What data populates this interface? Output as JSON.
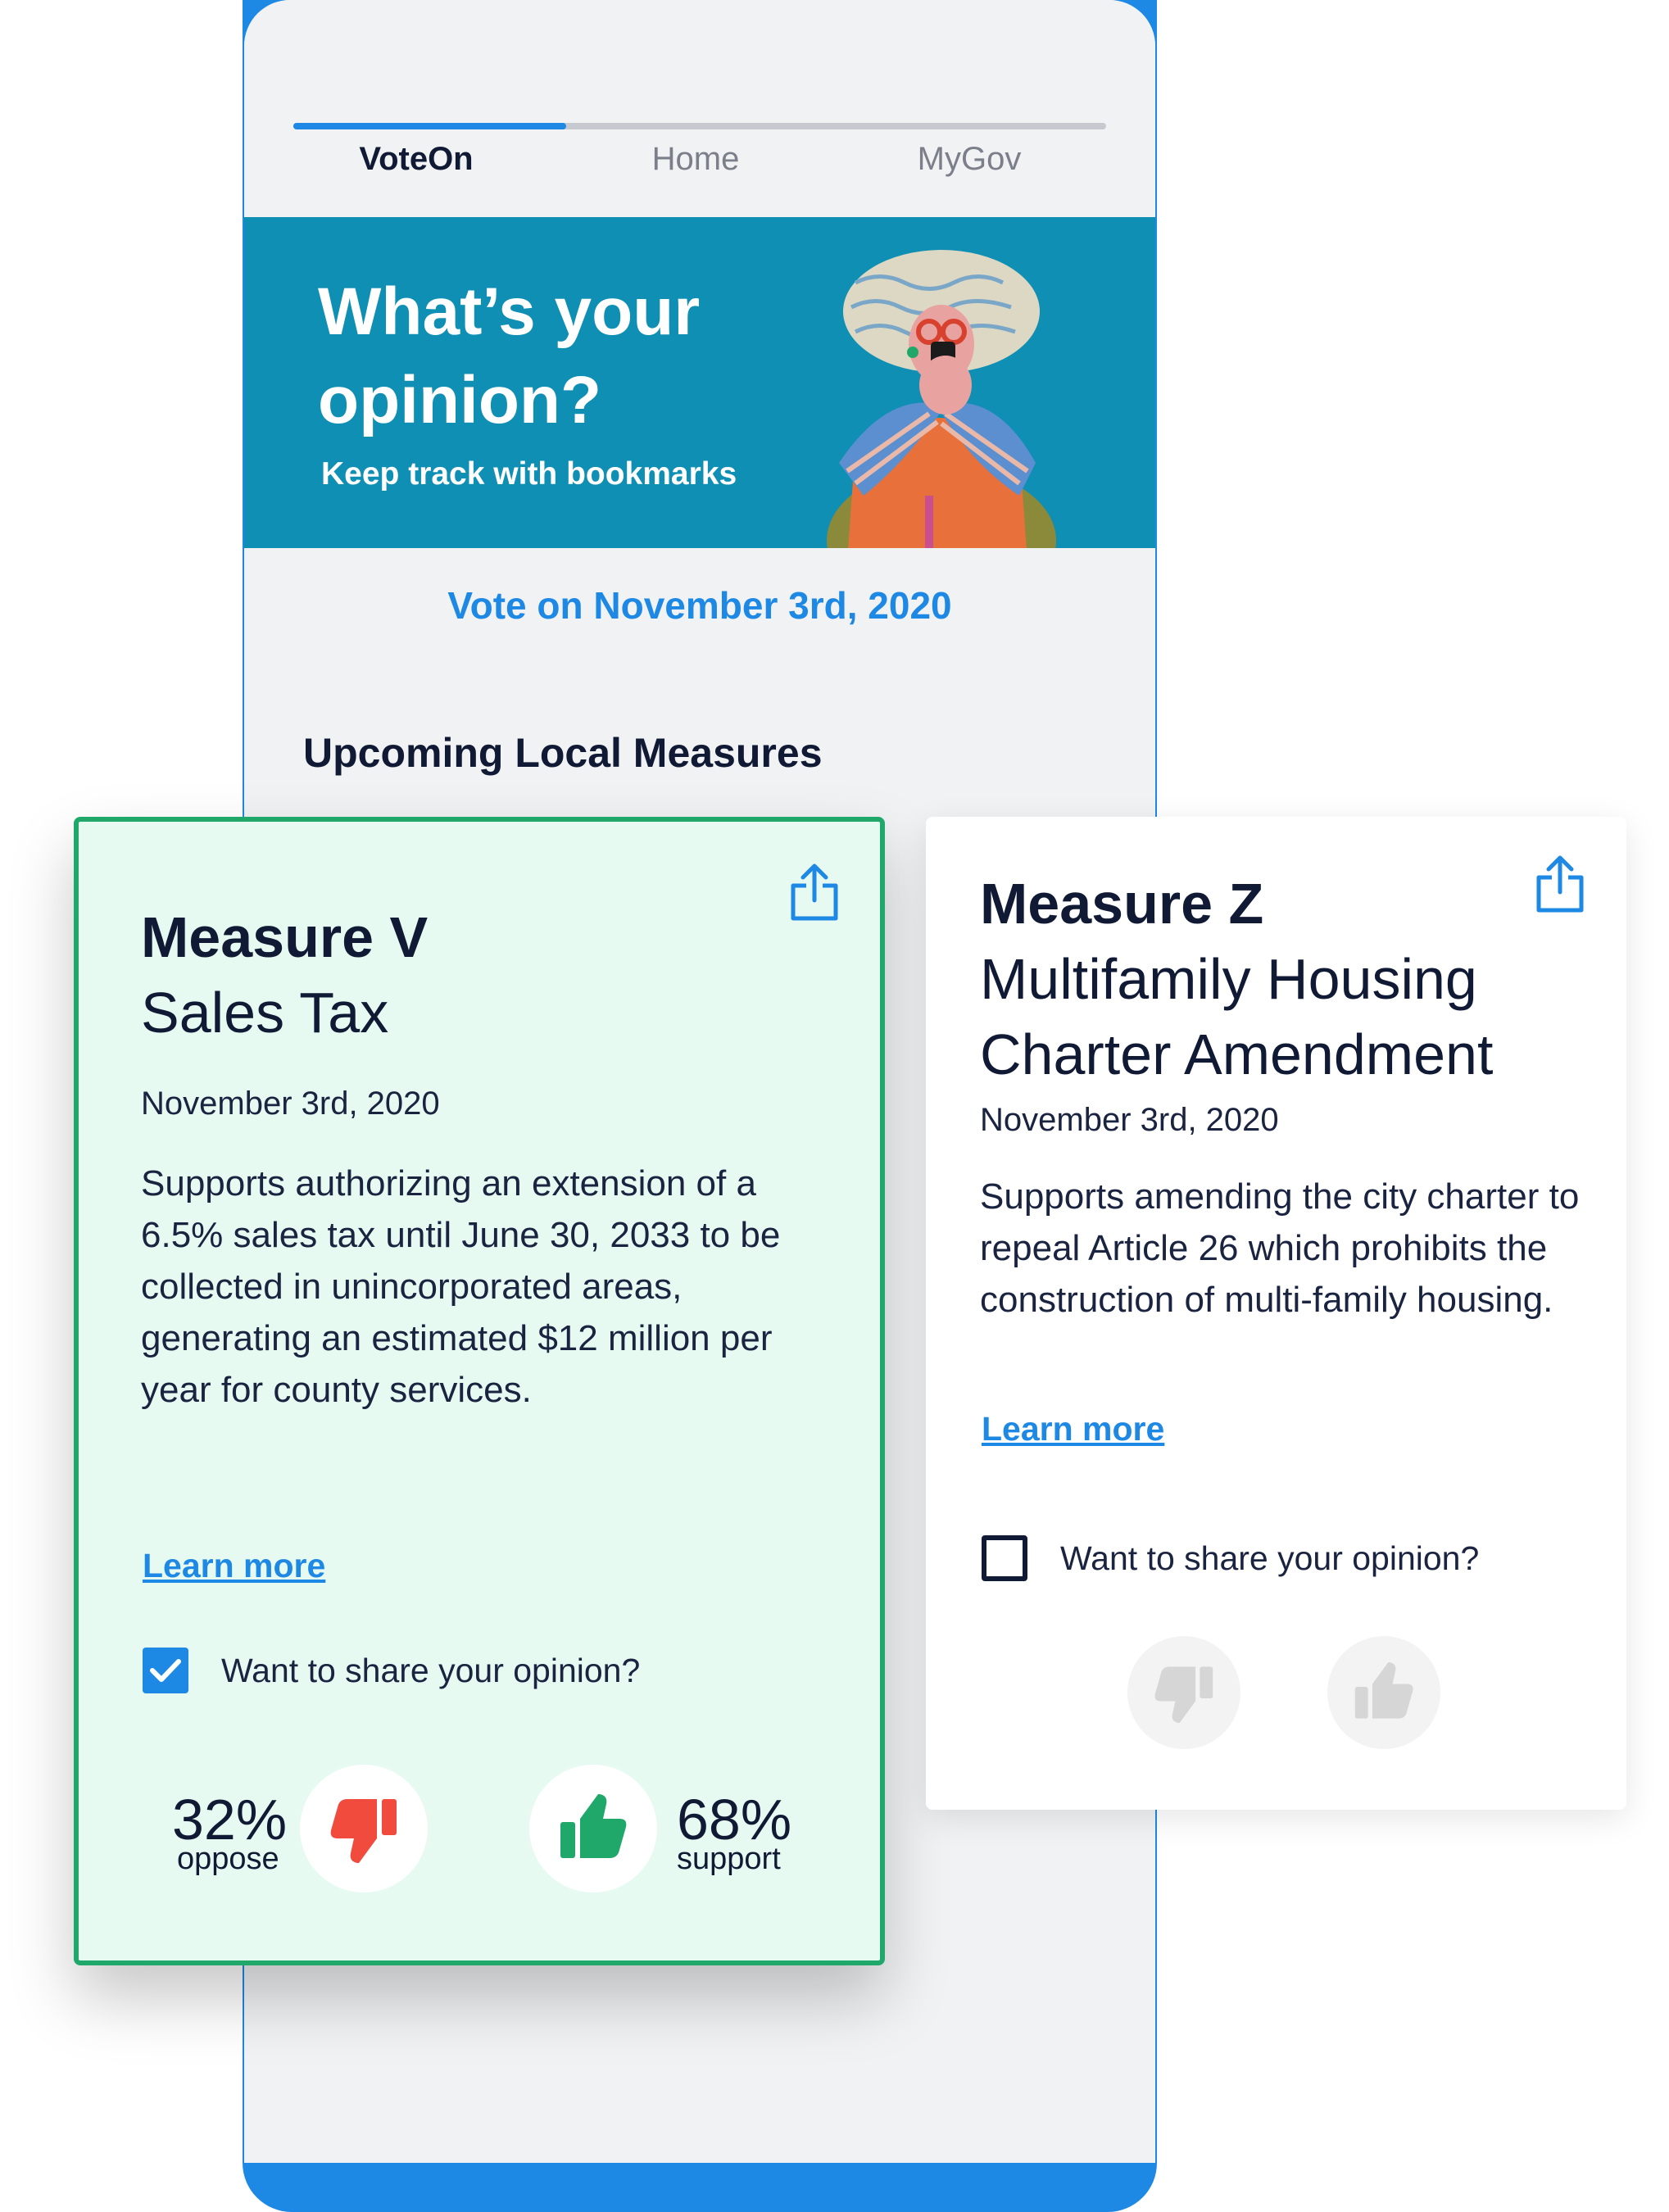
{
  "tabs": [
    {
      "label": "VoteOn",
      "active": true
    },
    {
      "label": "Home",
      "active": false
    },
    {
      "label": "MyGov",
      "active": false
    }
  ],
  "hero": {
    "title": "What’s your opinion?",
    "subtitle": "Keep track with bookmarks"
  },
  "vote_date": "Vote on November 3rd, 2020",
  "section_title": "Upcoming Local Measures",
  "measures": [
    {
      "title_line1": "Measure V",
      "title_line2": "Sales Tax",
      "date": "November 3rd, 2020",
      "description": "Supports authorizing an extension of a 6.5% sales tax until June 30, 2033 to be collected in unincorporated areas, generating an estimated $12 million per year for county services.",
      "learn_more": "Learn more",
      "share_opinion_label": "Want to share your opinion?",
      "share_opinion_checked": true,
      "oppose_percent": "32%",
      "oppose_label": "oppose",
      "support_percent": "68%",
      "support_label": "support"
    },
    {
      "title_line1": "Measure Z",
      "title_line2": "Multifamily Housing",
      "title_line3": "Charter Amendment",
      "date": "November 3rd, 2020",
      "description": "Supports amending the city charter to repeal Article 26 which prohibits the construction of multi-family housing.",
      "learn_more": "Learn more",
      "share_opinion_label": "Want to share your opinion?",
      "share_opinion_checked": false
    }
  ],
  "colors": {
    "accent": "#1e88e5",
    "hero_bg": "#0f8fb3",
    "card_selected_bg": "#e7faf2",
    "card_selected_border": "#1fa86a",
    "oppose": "#f04b3c",
    "support": "#1fa86a"
  }
}
